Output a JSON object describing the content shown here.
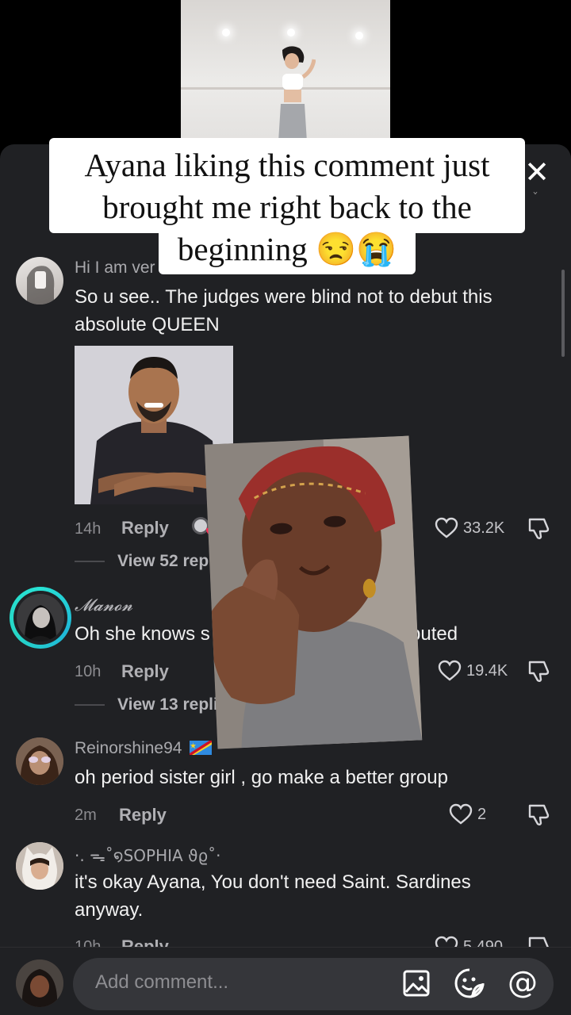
{
  "caption": {
    "line1": "Ayana liking this comment just",
    "line2": "brought me right back to the",
    "line3": "beginning 😒😭"
  },
  "comments": [
    {
      "username": "Hi I am ver",
      "text": "So u see.. The judges were blind not to debut this absolute QUEEN",
      "time": "14h",
      "reply_label": "Reply",
      "likes": "33.2K",
      "view_replies": "View 52 replies"
    },
    {
      "username": "𝓜𝓪𝓷𝓸𝓷",
      "text_left": "Oh she knows s",
      "text_right": "buted",
      "time": "10h",
      "reply_label": "Reply",
      "likes": "19.4K",
      "view_replies": "View 13 repli"
    },
    {
      "username": "Reinorshine94",
      "text": "oh period sister girl , go make a better group",
      "time": "2m",
      "reply_label": "Reply",
      "likes": "2"
    },
    {
      "username": "·. ᯓ˚໑SOPHIA ϑϱ˚·",
      "text": "it's okay Ayana, You don't need Saint. Sardines anyway.",
      "time": "10h",
      "reply_label": "Reply",
      "likes": "5,490"
    }
  ],
  "input": {
    "placeholder": "Add comment..."
  },
  "icons": {
    "close": "close-icon",
    "heart": "heart-icon",
    "dislike": "dislike-icon",
    "image": "image-icon",
    "sticker": "sticker-icon",
    "mention": "at-icon"
  },
  "colors": {
    "sheet_bg": "#202124",
    "text": "#f1f1f1",
    "muted": "#8c8c90"
  }
}
